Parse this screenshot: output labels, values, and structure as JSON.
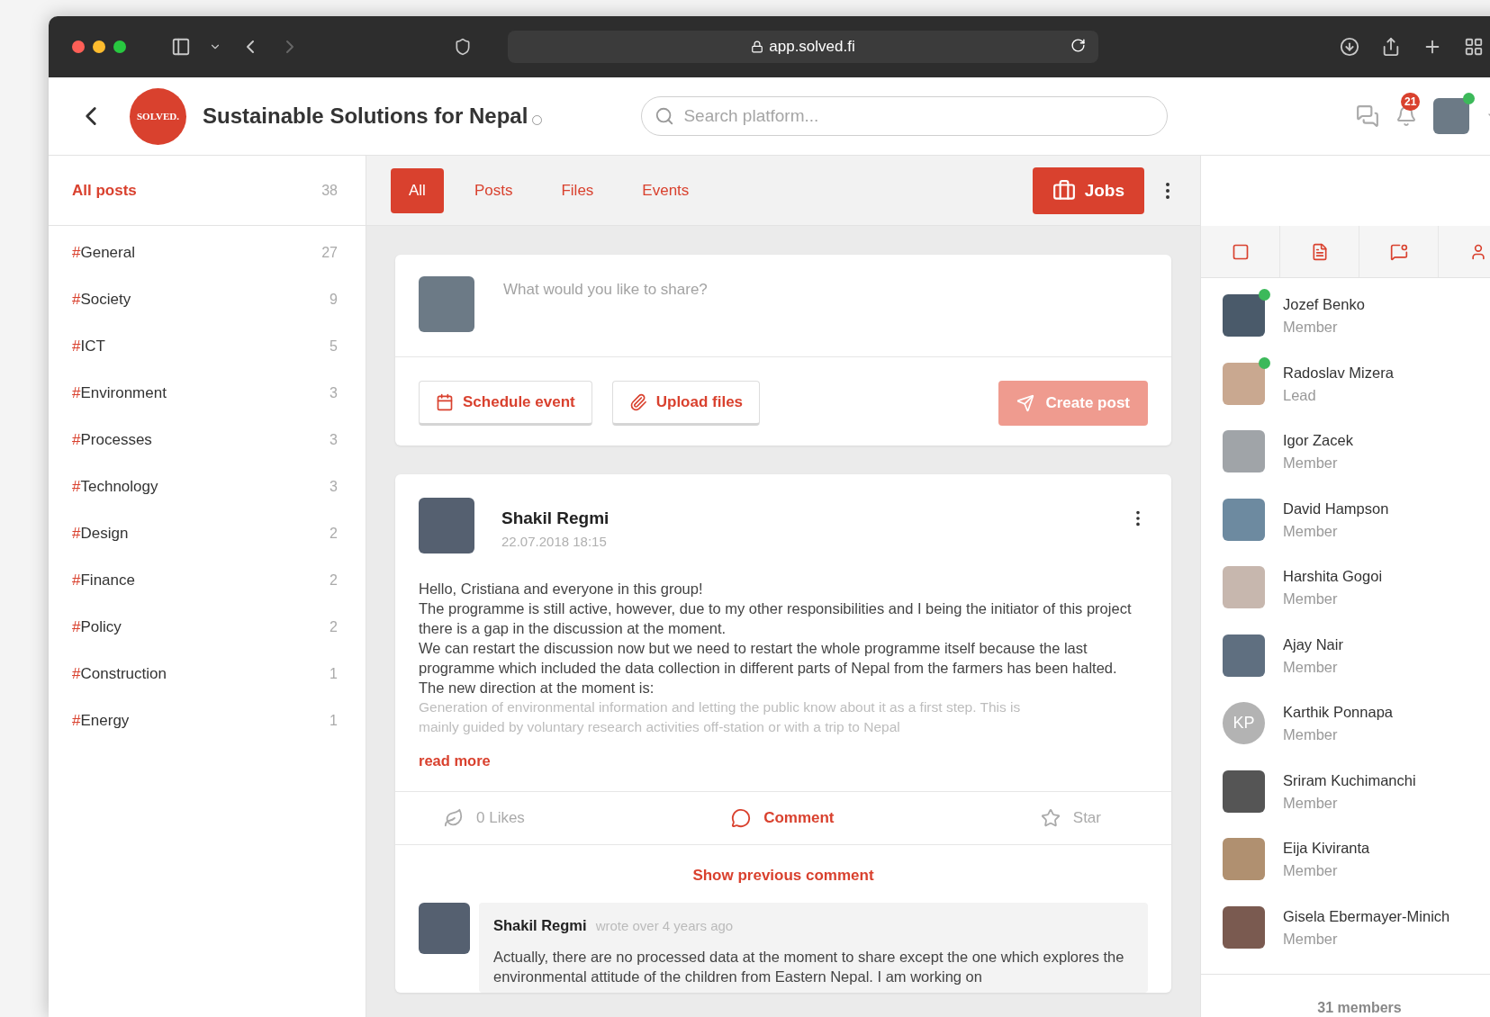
{
  "browser": {
    "url": "app.solved.fi"
  },
  "header": {
    "logo": "SOLVED.",
    "title": "Sustainable Solutions for Nepal",
    "search": {
      "placeholder": "Search platform..."
    },
    "notifications": "21",
    "user_online": true
  },
  "sidebar": {
    "items": [
      {
        "label": "All posts",
        "count": "38",
        "selected": true
      },
      {
        "prefix": "#",
        "label": "General",
        "count": "27",
        "selected": false
      },
      {
        "prefix": "#",
        "label": "Society",
        "count": "9",
        "selected": false
      },
      {
        "prefix": "#",
        "label": "ICT",
        "count": "5",
        "selected": false
      },
      {
        "prefix": "#",
        "label": "Environment",
        "count": "3",
        "selected": false
      },
      {
        "prefix": "#",
        "label": "Processes",
        "count": "3",
        "selected": false
      },
      {
        "prefix": "#",
        "label": "Technology",
        "count": "3",
        "selected": false
      },
      {
        "prefix": "#",
        "label": "Design",
        "count": "2",
        "selected": false
      },
      {
        "prefix": "#",
        "label": "Finance",
        "count": "2",
        "selected": false
      },
      {
        "prefix": "#",
        "label": "Policy",
        "count": "2",
        "selected": false
      },
      {
        "prefix": "#",
        "label": "Construction",
        "count": "1",
        "selected": false
      },
      {
        "prefix": "#",
        "label": "Energy",
        "count": "1",
        "selected": false
      }
    ]
  },
  "tabs": [
    {
      "label": "All",
      "selected": true
    },
    {
      "label": "Posts",
      "selected": false
    },
    {
      "label": "Files",
      "selected": false
    },
    {
      "label": "Events",
      "selected": false
    }
  ],
  "jobs_button": "Jobs",
  "composer": {
    "placeholder": "What would you like to share?",
    "buttons": [
      "Schedule event",
      "Upload files"
    ],
    "create": {
      "label": "Create post",
      "disabled": true
    }
  },
  "post": {
    "author": "Shakil Regmi",
    "date": "22.07.2018 18:15",
    "lines": [
      {
        "text": "Hello, Cristiana and everyone in this group!",
        "faded": false
      },
      {
        "text": "The programme is still active, however, due to my other responsibilities and I being the initiator of this project there is a gap in the discussion at the moment.",
        "faded": false
      },
      {
        "text": "We can restart the discussion now but we need to restart the whole programme itself because the last programme which included the data collection in different parts of Nepal from the farmers has been halted.",
        "faded": false
      },
      {
        "text": "The new direction at the moment is:",
        "faded": false
      },
      {
        "text": "Generation of environmental information and letting the public know about it as a first step. This is",
        "faded": true
      },
      {
        "text": "mainly guided by voluntary research activities off-station or with a trip to Nepal",
        "faded": true
      }
    ],
    "read_more": "read more",
    "likes": "0 Likes",
    "comment": "Comment",
    "star": "Star",
    "show_previous": "Show previous comment",
    "comment_item": {
      "author": "Shakil Regmi",
      "time": "wrote over 4 years ago",
      "text": "Actually, there are no processed data at the moment to share except the one which explores the environmental attitude of the children from Eastern Nepal. I am working on"
    }
  },
  "members": {
    "list": [
      {
        "name": "Jozef Benko",
        "role": "Member",
        "online": true,
        "kind": "photo"
      },
      {
        "name": "Radoslav Mizera",
        "role": "Lead",
        "online": true,
        "kind": "photo"
      },
      {
        "name": "Igor Zacek",
        "role": "Member",
        "online": false,
        "kind": "photo"
      },
      {
        "name": "David Hampson",
        "role": "Member",
        "online": false,
        "kind": "photo"
      },
      {
        "name": "Harshita Gogoi",
        "role": "Member",
        "online": false,
        "kind": "photo"
      },
      {
        "name": "Ajay Nair",
        "role": "Member",
        "online": false,
        "kind": "photo"
      },
      {
        "name": "Karthik Ponnapa",
        "role": "Member",
        "online": false,
        "kind": "initials",
        "initials": "KP"
      },
      {
        "name": "Sriram Kuchimanchi",
        "role": "Member",
        "online": false,
        "kind": "photo"
      },
      {
        "name": "Eija Kiviranta",
        "role": "Member",
        "online": false,
        "kind": "photo"
      },
      {
        "name": "Gisela Ebermayer-Minich",
        "role": "Member",
        "online": false,
        "kind": "photo"
      }
    ],
    "count": "31 members"
  }
}
